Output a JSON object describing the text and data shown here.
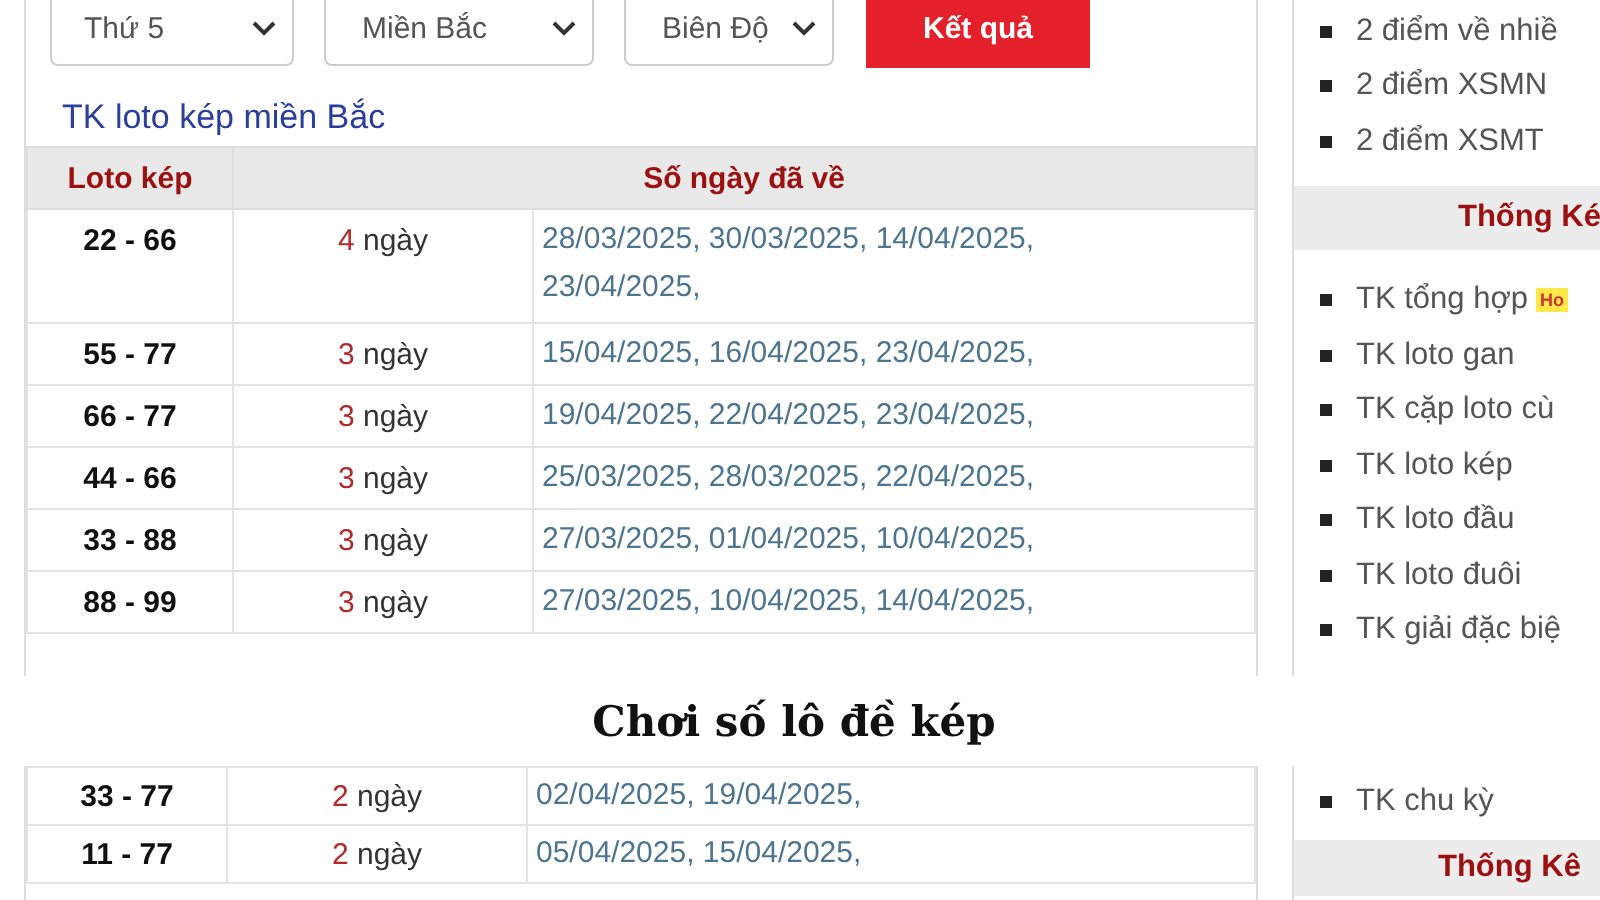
{
  "filters": [
    {
      "value": "Thứ 5"
    },
    {
      "value": "Miền Bắc"
    },
    {
      "value": "Biên Độ"
    }
  ],
  "submit_button": "Kết quả",
  "section_link": "TK loto kép miền Bắc",
  "table": {
    "columns": [
      "Loto kép",
      "Số ngày đã về"
    ],
    "rows": [
      {
        "pair": "22 - 66",
        "count": "4",
        "unit": "ngày",
        "dates": "28/03/2025, 30/03/2025, 14/04/2025, 23/04/2025,"
      },
      {
        "pair": "55 - 77",
        "count": "3",
        "unit": "ngày",
        "dates": "15/04/2025, 16/04/2025, 23/04/2025,"
      },
      {
        "pair": "66 - 77",
        "count": "3",
        "unit": "ngày",
        "dates": "19/04/2025, 22/04/2025, 23/04/2025,"
      },
      {
        "pair": "44 - 66",
        "count": "3",
        "unit": "ngày",
        "dates": "25/03/2025, 28/03/2025, 22/04/2025,"
      },
      {
        "pair": "33 - 88",
        "count": "3",
        "unit": "ngày",
        "dates": "27/03/2025, 01/04/2025, 10/04/2025,"
      },
      {
        "pair": "88 - 99",
        "count": "3",
        "unit": "ngày",
        "dates": "27/03/2025, 10/04/2025, 14/04/2025,"
      }
    ]
  },
  "sidebar": {
    "groups": [
      {
        "items": [
          {
            "label": "2 điểm về nhiề"
          },
          {
            "label": "2 điểm XSMN"
          },
          {
            "label": "2 điểm XSMT"
          }
        ]
      },
      {
        "header": "Thống Ké",
        "items": [
          {
            "label": "TK tổng hợp",
            "badge": "Ho"
          },
          {
            "label": "TK loto gan"
          },
          {
            "label": "TK cặp loto cù"
          },
          {
            "label": "TK loto kép"
          },
          {
            "label": "TK loto đầu"
          },
          {
            "label": "TK loto đuôi"
          },
          {
            "label": "TK giải đặc biệ"
          }
        ]
      }
    ]
  },
  "caption": "Chơi số lô đề kép",
  "table_continued": {
    "rows": [
      {
        "pair": "33 - 77",
        "count": "2",
        "unit": "ngày",
        "dates": "02/04/2025, 19/04/2025,"
      },
      {
        "pair": "11 - 77",
        "count": "2",
        "unit": "ngày",
        "dates": "05/04/2025, 15/04/2025,"
      }
    ]
  },
  "sidebar_continued": {
    "groups": [
      {
        "items": [
          {
            "label": "TK chu kỳ"
          }
        ]
      },
      {
        "header": "Thống Kê"
      }
    ]
  }
}
